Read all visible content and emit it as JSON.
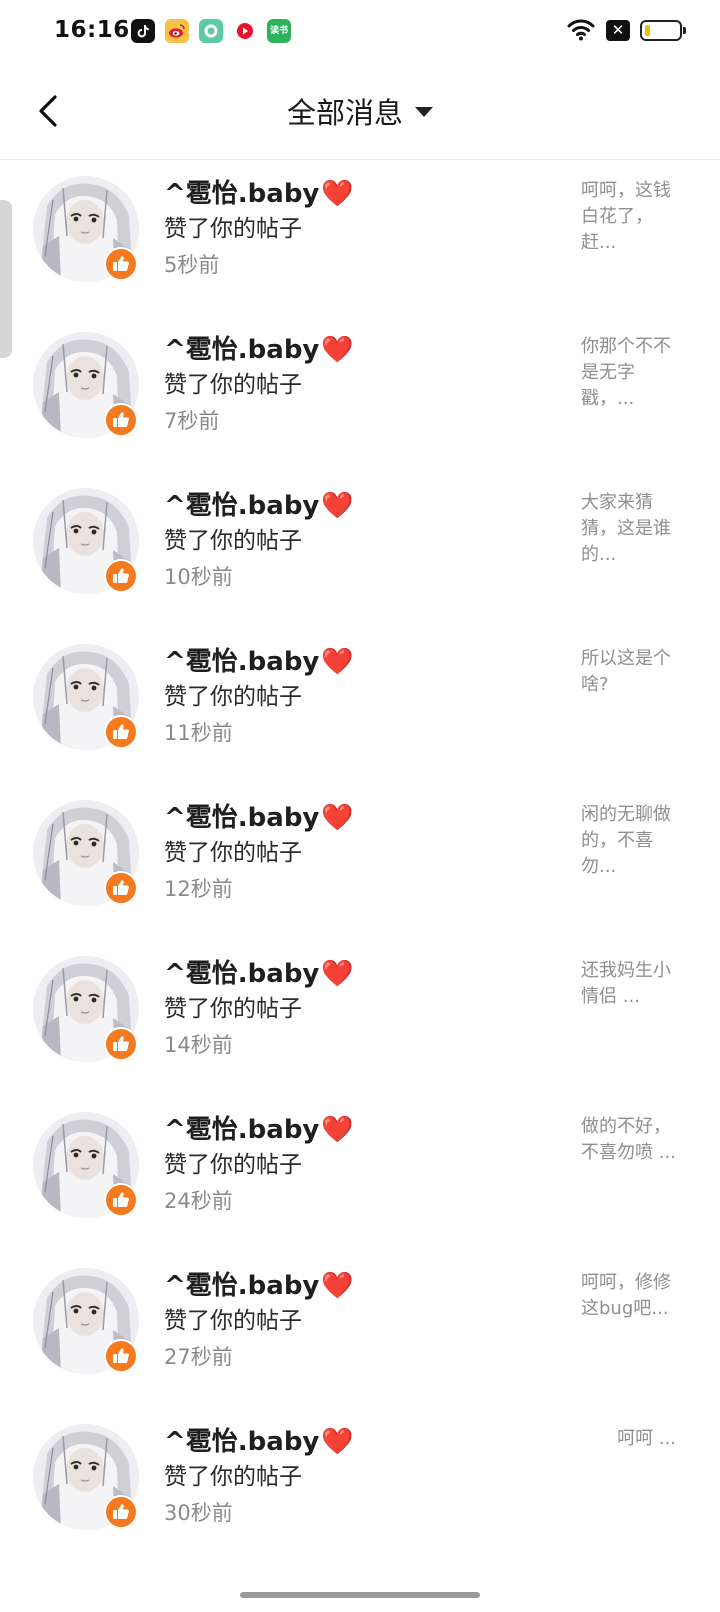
{
  "status_bar": {
    "time": "16:16",
    "app_icons": [
      "tiktok-icon",
      "weibo-icon",
      "app-ring-icon",
      "red-play-icon",
      "reading-app-icon"
    ],
    "reading_app_text": "读书",
    "x_badge": "✕"
  },
  "header": {
    "title": "全部消息"
  },
  "messages": [
    {
      "user": "^雹怡.baby",
      "heart": "❤️",
      "action": "赞了你的帖子",
      "time": "5秒前",
      "preview": "呵呵，这钱白花了，赶..."
    },
    {
      "user": "^雹怡.baby",
      "heart": "❤️",
      "action": "赞了你的帖子",
      "time": "7秒前",
      "preview": "你那个不不是无字戳，..."
    },
    {
      "user": "^雹怡.baby",
      "heart": "❤️",
      "action": "赞了你的帖子",
      "time": "10秒前",
      "preview": "大家来猜猜，这是谁的..."
    },
    {
      "user": "^雹怡.baby",
      "heart": "❤️",
      "action": "赞了你的帖子",
      "time": "11秒前",
      "preview": "所以这是个啥?"
    },
    {
      "user": "^雹怡.baby",
      "heart": "❤️",
      "action": "赞了你的帖子",
      "time": "12秒前",
      "preview": "闲的无聊做的，不喜勿..."
    },
    {
      "user": "^雹怡.baby",
      "heart": "❤️",
      "action": "赞了你的帖子",
      "time": "14秒前",
      "preview": "还我妈生小情侣 ..."
    },
    {
      "user": "^雹怡.baby",
      "heart": "❤️",
      "action": "赞了你的帖子",
      "time": "24秒前",
      "preview": "做的不好，不喜勿喷 ..."
    },
    {
      "user": "^雹怡.baby",
      "heart": "❤️",
      "action": "赞了你的帖子",
      "time": "27秒前",
      "preview": "呵呵，修修这bug吧..."
    },
    {
      "user": "^雹怡.baby",
      "heart": "❤️",
      "action": "赞了你的帖子",
      "time": "30秒前",
      "preview": "呵呵 ..."
    }
  ],
  "colors": {
    "like_badge": "#f47a20",
    "heart": "#e8142e",
    "secondary_text": "#8a8a8a"
  }
}
